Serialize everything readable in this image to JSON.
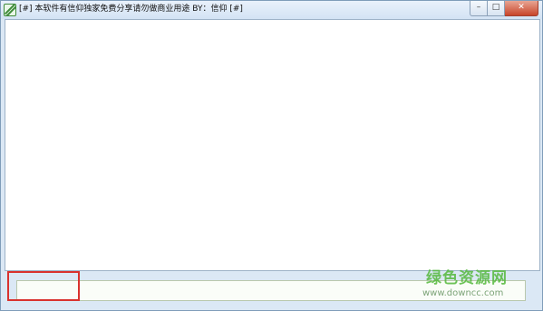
{
  "window": {
    "title": "[#] 本软件有信仰独家免费分享请勿做商业用途 BY：信仰 [#]",
    "controls": {
      "minimize": "–",
      "maximize": "□",
      "close": "✕"
    }
  },
  "icons": {
    "app": "app-logo-icon"
  },
  "bottom_input": {
    "value": ""
  },
  "watermark": {
    "name": "绿色资源网",
    "url": "www.downcc.com"
  },
  "colors": {
    "highlight": "#d9322e",
    "watermark": "#55b93d"
  }
}
